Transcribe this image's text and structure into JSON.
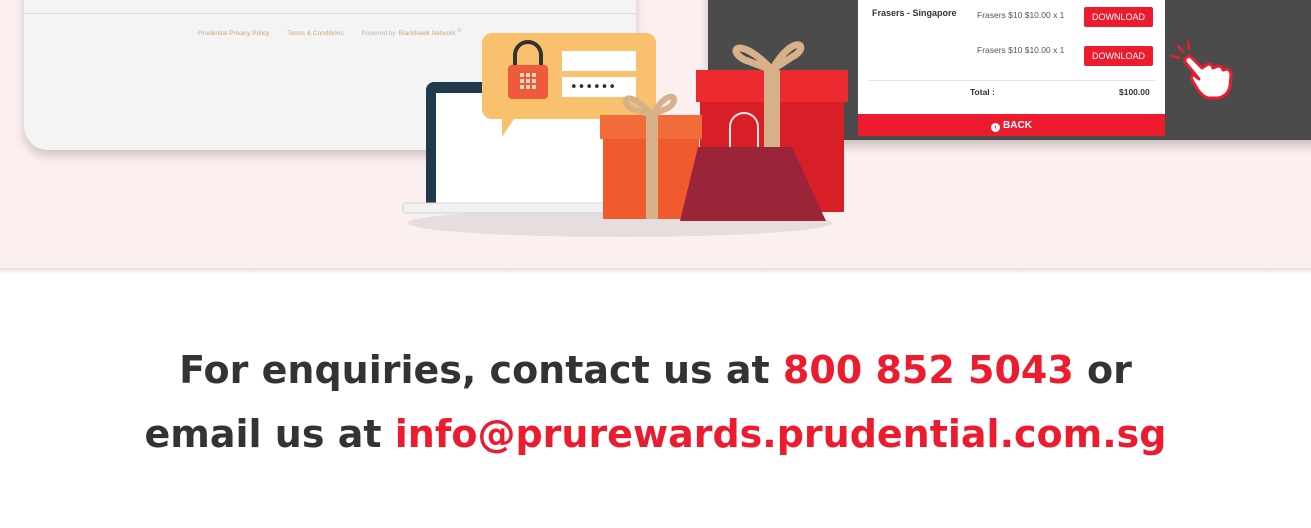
{
  "left_window": {
    "footer_links": [
      "Prudential Privacy Policy",
      "Terms & Conditions"
    ],
    "powered_by": "Powered by",
    "powered_brand": "Blackhawk Network",
    "powered_mark": "®"
  },
  "voucher_panel": {
    "merchant": "Frasers - Singapore",
    "items": [
      {
        "text": "Frasers $10 $10.00 x 1",
        "button": "DOWNLOAD"
      },
      {
        "text": "Frasers $10 $10.00 x 1",
        "button": "DOWNLOAD"
      }
    ],
    "total_label": "Total :",
    "total_value": "$100.00",
    "back_label": "BACK"
  },
  "login_bubble": {
    "password_mask": "••••••"
  },
  "contact": {
    "line1_prefix": "For enquiries, contact us at ",
    "phone": "800 852 5043",
    "line1_suffix": " or",
    "line2_prefix": "email us at ",
    "email": "info@prurewards.prudential.com.sg"
  },
  "colors": {
    "accent": "#ed1b2e",
    "text": "#333333",
    "hero_bg": "#fcefef",
    "device": "#4b4b4b"
  },
  "icons": [
    "lock-icon",
    "back-circle-icon",
    "pointing-hand-icon",
    "gift-box-icon",
    "shopping-bag-icon",
    "laptop-icon"
  ]
}
